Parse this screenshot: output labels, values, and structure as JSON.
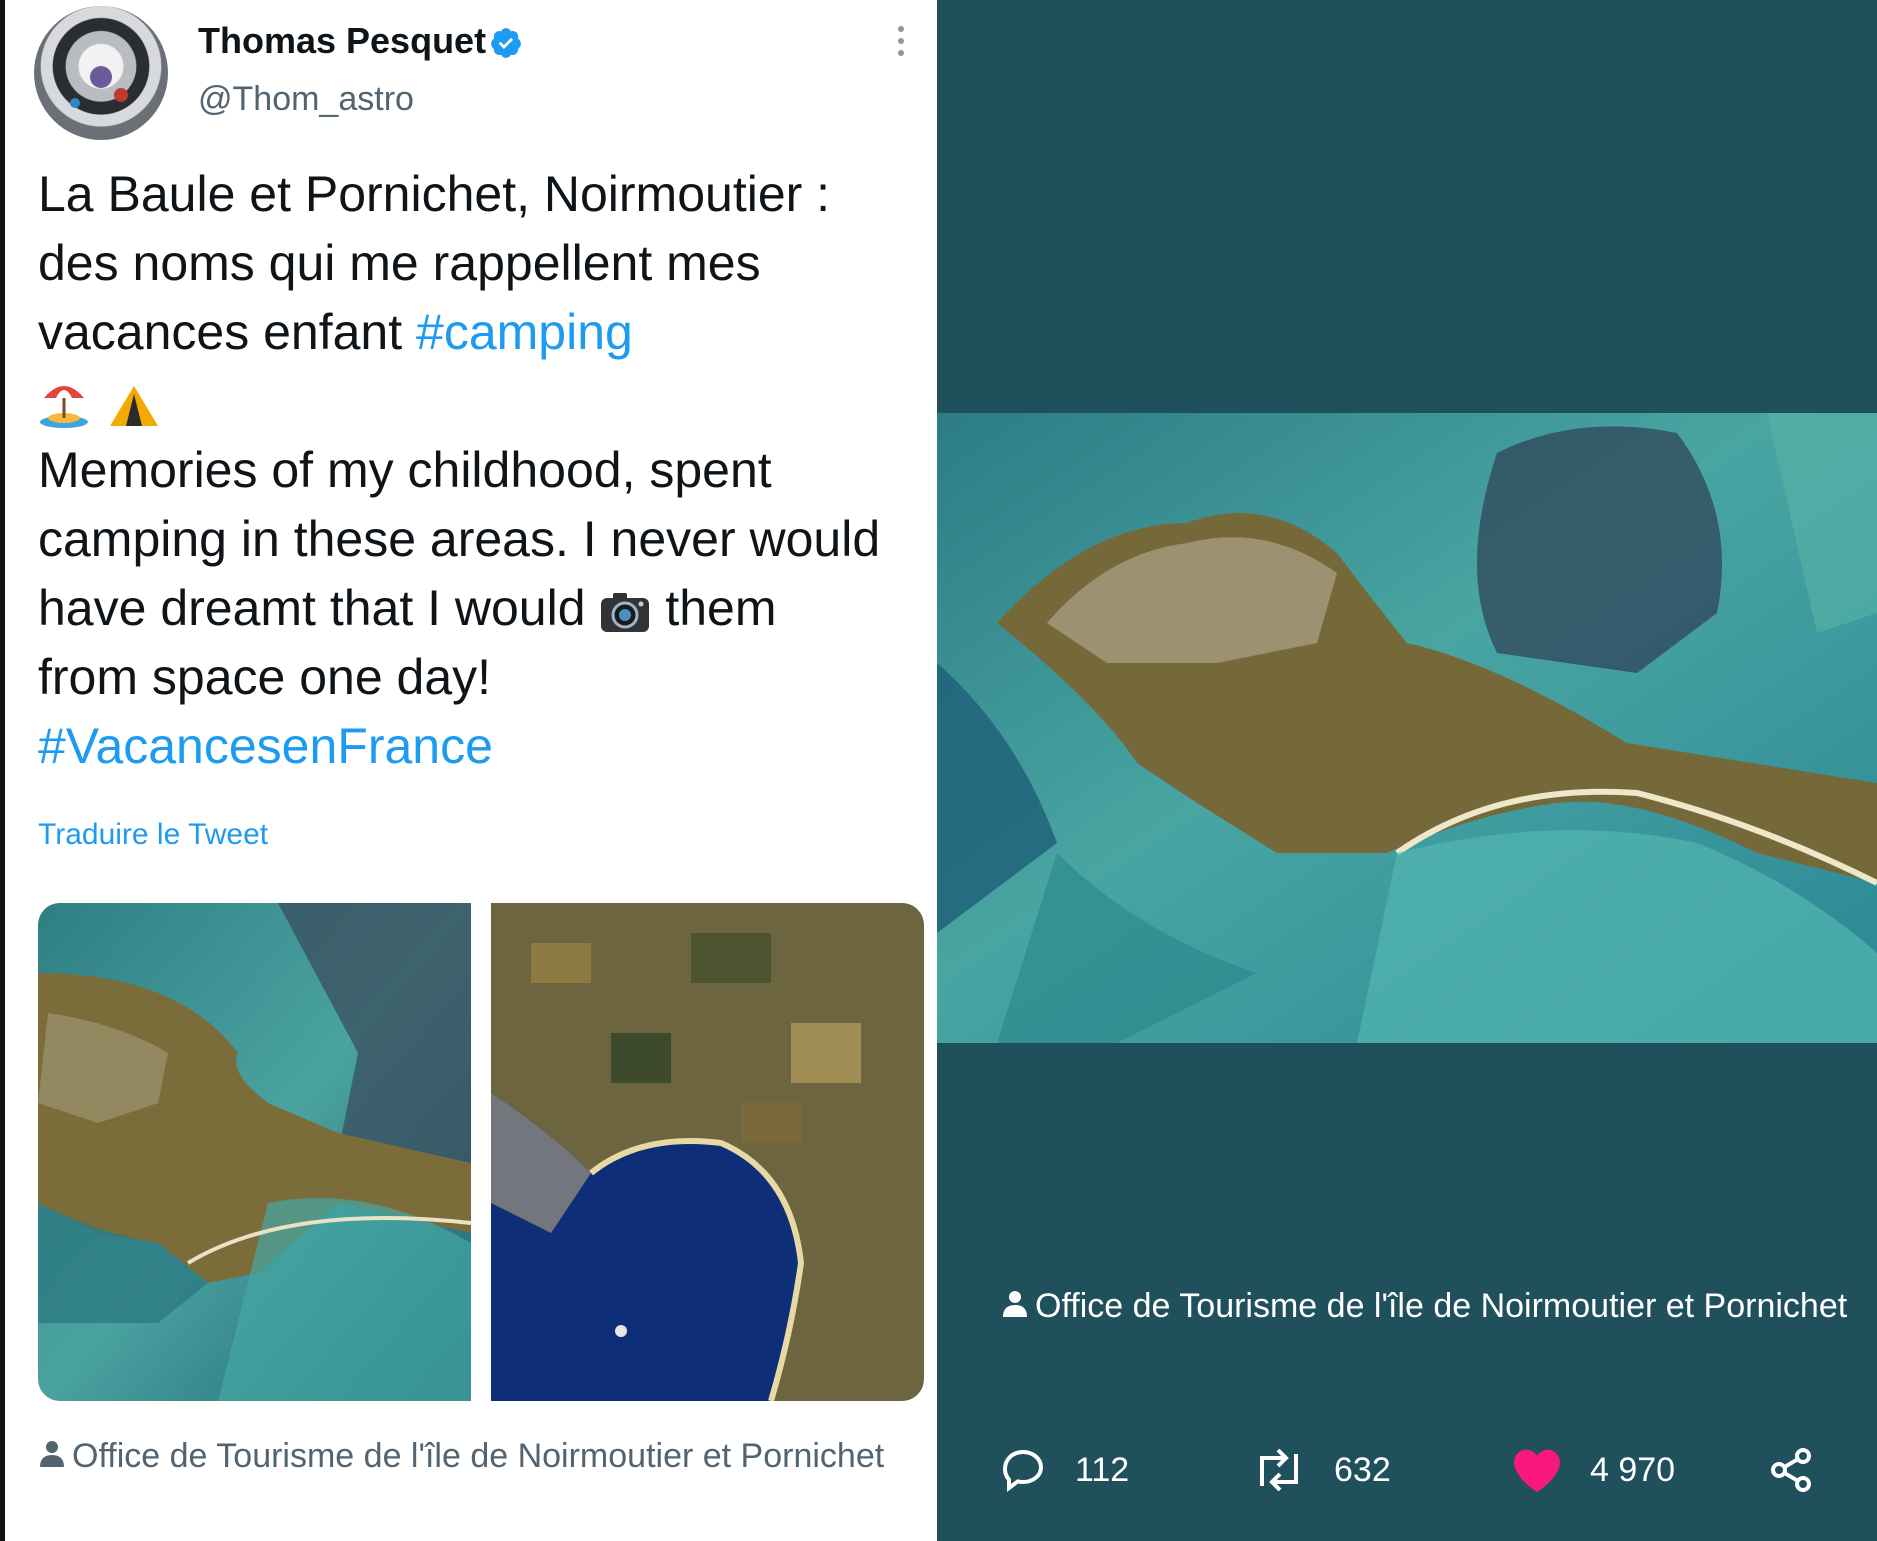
{
  "tweet": {
    "author_name": "Thomas Pesquet",
    "author_handle": "@Thom_astro",
    "text_lines": [
      "La Baule et Pornichet, Noirmoutier :",
      "des noms qui me rappellent mes",
      "vacances enfant "
    ],
    "hashtag_camping": "#camping",
    "text_lines_2": [
      "Memories of my childhood, spent",
      "camping in these areas. I never would",
      "have dreamt that I would "
    ],
    "text_them": " them",
    "text_last": "from space one day!",
    "hashtag_vacances": "#VacancesenFrance",
    "translate_label": "Traduire le Tweet",
    "photo_credit": "Office de Tourisme de l'île de Noirmoutier et Pornichet"
  },
  "viewer": {
    "photo_credit": "Office de Tourisme de l'île de Noirmoutier et Pornichet",
    "replies": "112",
    "retweets": "632",
    "likes": "4 970"
  },
  "colors": {
    "accent": "#1d9bf0",
    "viewer_bg": "#1f505c",
    "like": "#f91880"
  }
}
